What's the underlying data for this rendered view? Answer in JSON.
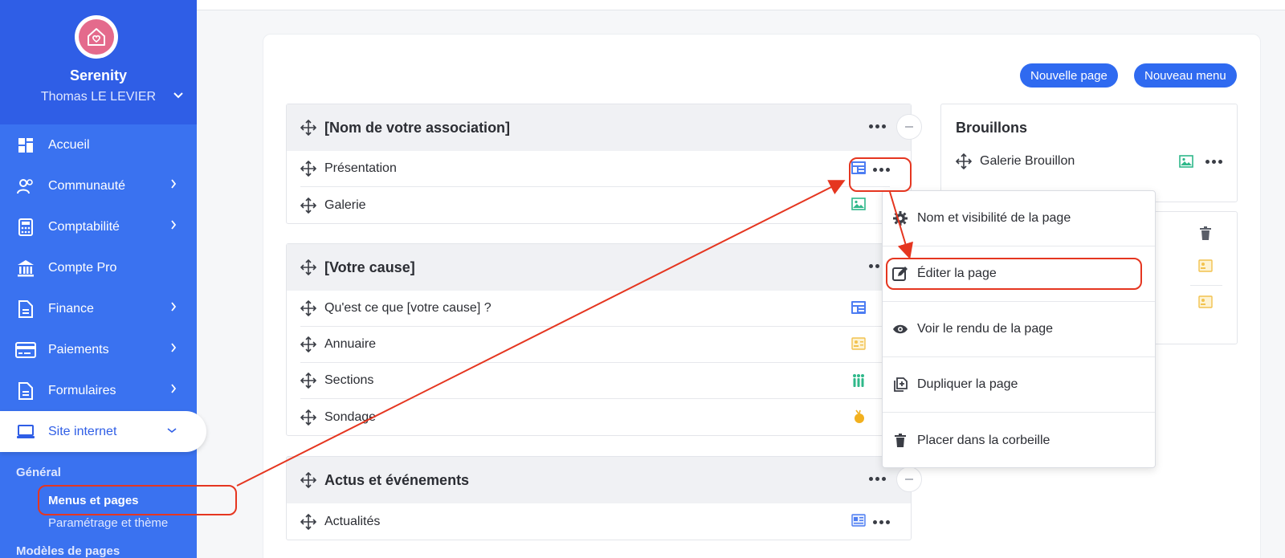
{
  "sidebar": {
    "org_name": "Serenity",
    "user_name": "Thomas LE LEVIER",
    "items": [
      {
        "label": "Accueil",
        "icon": "dashboard-icon"
      },
      {
        "label": "Communauté",
        "icon": "people-icon"
      },
      {
        "label": "Comptabilité",
        "icon": "calculator-icon"
      },
      {
        "label": "Compte Pro",
        "icon": "bank-icon"
      },
      {
        "label": "Finance",
        "icon": "document-icon"
      },
      {
        "label": "Paiements",
        "icon": "credit-card-icon"
      },
      {
        "label": "Formulaires",
        "icon": "form-icon"
      },
      {
        "label": "Site internet",
        "icon": "laptop-icon"
      }
    ],
    "sub_heading": "Général",
    "sub_links": [
      "Menus et pages",
      "Paramétrage et thème"
    ],
    "sub_heading_2": "Modèles de pages"
  },
  "toolbar": {
    "new_page": "Nouvelle page",
    "new_menu": "Nouveau menu"
  },
  "menus": [
    {
      "title": "[Nom de votre association]",
      "pages": [
        {
          "label": "Présentation",
          "icon": "layout-icon"
        },
        {
          "label": "Galerie",
          "icon": "image-icon"
        }
      ]
    },
    {
      "title": "[Votre cause]",
      "pages": [
        {
          "label": "Qu'est ce que [votre cause] ?",
          "icon": "layout-icon"
        },
        {
          "label": "Annuaire",
          "icon": "contact-card-icon"
        },
        {
          "label": "Sections",
          "icon": "group-icon"
        },
        {
          "label": "Sondage",
          "icon": "poll-icon"
        }
      ]
    },
    {
      "title": "Actus et événements",
      "pages": [
        {
          "label": "Actualités",
          "icon": "news-icon"
        }
      ]
    }
  ],
  "drafts": {
    "title": "Brouillons",
    "items": [
      {
        "label": "Galerie Brouillon",
        "icon": "image-icon"
      }
    ]
  },
  "context_menu": {
    "items": [
      {
        "label": "Nom et visibilité de la page",
        "icon": "gear-icon"
      },
      {
        "label": "Éditer la page",
        "icon": "edit-icon"
      },
      {
        "label": "Voir le rendu de la page",
        "icon": "eye-icon"
      },
      {
        "label": "Dupliquer la page",
        "icon": "duplicate-icon"
      },
      {
        "label": "Placer dans la corbeille",
        "icon": "trash-icon"
      }
    ]
  },
  "colors": {
    "sidebar": "#3a72f0",
    "accent": "#2f6af0",
    "annotation": "#e53620"
  }
}
